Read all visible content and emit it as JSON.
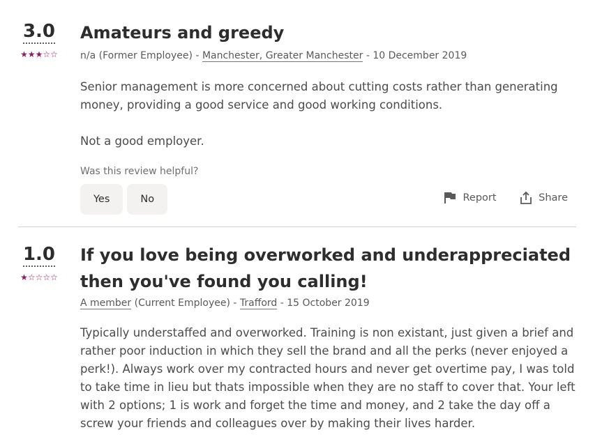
{
  "reviews": [
    {
      "rating": "3.0",
      "stars_filled": 3,
      "stars_total": 5,
      "title": "Amateurs and greedy",
      "author": "n/a",
      "author_role": "(Former Employee)",
      "sep1": " - ",
      "location": "Manchester, Greater Manchester",
      "sep2": " - ",
      "date": "10 December 2019",
      "paragraphs": [
        "Senior management is more concerned about cutting costs rather than generating money, providing a good service and good working conditions.",
        "Not a good employer."
      ],
      "helpful_question": "Was this review helpful?",
      "yes_label": "Yes",
      "no_label": "No",
      "report_label": "Report",
      "share_label": "Share"
    },
    {
      "rating": "1.0",
      "stars_filled": 1,
      "stars_total": 5,
      "title": "If you love being overworked and underappreciated then you've found you calling!",
      "author": "A member",
      "author_role": " (Current Employee)",
      "sep1": " - ",
      "location": "Trafford",
      "sep2": " - ",
      "date": "15 October 2019",
      "paragraphs": [
        "Typically understaffed and overworked. Training is non existant, just given a brief and rather poor induction in which they sell the brand and all the perks (never enjoyed a perk!). Always work over my contracted hours and never get overtime pay, I was told to take time in lieu but thats impossible when they are no staff to cover that. Your left with 2 options; 1 is work and forget the time and money, and 2 take the day off a screw your friends and colleagues over by making their lives harder."
      ]
    }
  ],
  "colors": {
    "star": "#8b1e5c",
    "text": "#2d2d2d",
    "muted": "#595959",
    "button_bg": "#f3f2f1"
  },
  "icons": {
    "flag": "flag-icon",
    "share": "share-icon"
  }
}
